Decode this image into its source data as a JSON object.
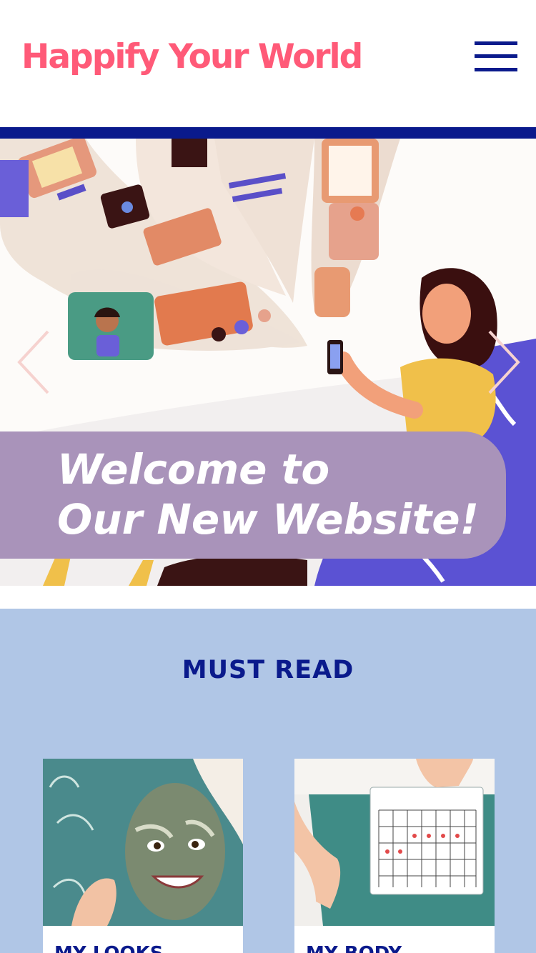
{
  "header": {
    "logo_text": "Happify Your World",
    "menu_icon": "hamburger-menu-icon"
  },
  "hero": {
    "line1": "Welcome to",
    "line2": "Our New Website!",
    "prev_icon": "chevron-left-icon",
    "next_icon": "chevron-right-icon"
  },
  "must_read": {
    "title": "MUST READ",
    "cards": [
      {
        "label": "MY LOOKS"
      },
      {
        "label": "MY BODY"
      }
    ]
  },
  "colors": {
    "brand_pink": "#ff5a78",
    "navy": "#0a1a8c",
    "banner_purple": "#a993ba",
    "section_bg": "#b0c6e6"
  }
}
